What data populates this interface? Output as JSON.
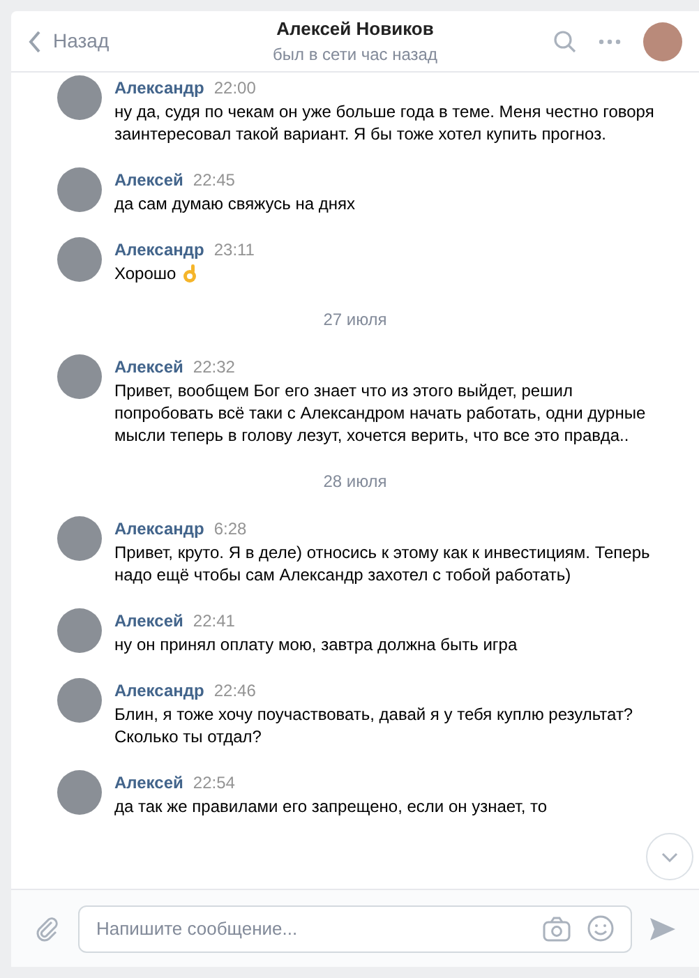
{
  "header": {
    "back_label": "Назад",
    "title": "Алексей Новиков",
    "subtitle": "был в сети час назад"
  },
  "feed": [
    {
      "kind": "message",
      "author": "Александр",
      "time": "22:00",
      "text": "ну да, судя по чекам он уже больше года в теме. Меня честно говоря заинтересовал такой вариант. Я бы тоже хотел купить прогноз."
    },
    {
      "kind": "message",
      "author": "Алексей",
      "time": "22:45",
      "text": "да сам думаю свяжусь на днях"
    },
    {
      "kind": "message_with_emoji",
      "author": "Александр",
      "time": "23:11",
      "text": "Хорошо"
    },
    {
      "kind": "date",
      "text": "27 июля"
    },
    {
      "kind": "message",
      "author": "Алексей",
      "time": "22:32",
      "text": "Привет, вообщем Бог его знает что из этого выйдет, решил попробовать всё таки с Александром начать работать, одни дурные мысли теперь в голову лезут, хочется верить, что все это правда.."
    },
    {
      "kind": "date",
      "text": "28 июля"
    },
    {
      "kind": "message",
      "author": "Александр",
      "time": "6:28",
      "text": "Привет, круто. Я в деле) относись к этому как к инвестициям. Теперь надо ещё чтобы сам Александр захотел с тобой работать)"
    },
    {
      "kind": "message",
      "author": "Алексей",
      "time": "22:41",
      "text": "ну он принял оплату мою, завтра должна быть игра"
    },
    {
      "kind": "message",
      "author": "Александр",
      "time": "22:46",
      "text": "Блин, я тоже хочу поучаствовать, давай я у тебя куплю результат? Сколько ты отдал?"
    },
    {
      "kind": "message",
      "author": "Алексей",
      "time": "22:54",
      "text": "да так же правилами его запрещено, если он узнает, то"
    }
  ],
  "composer": {
    "placeholder": "Напишите сообщение..."
  }
}
